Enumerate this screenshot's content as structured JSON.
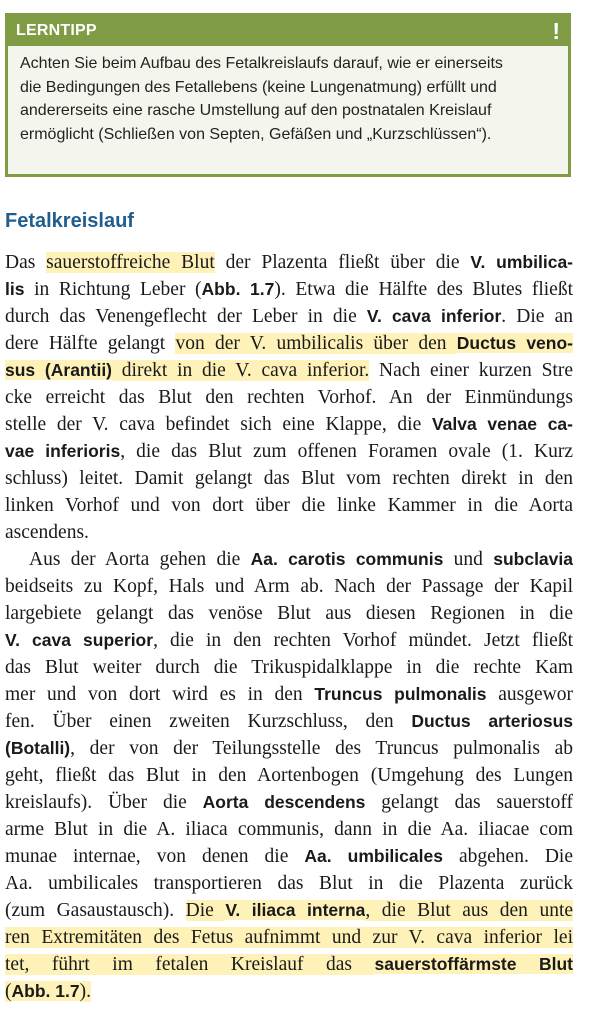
{
  "tip": {
    "title": "LERNTIPP",
    "icon": "exclamation-icon",
    "badge": "!",
    "color": "#7f9c45",
    "lines": [
      "Achten Sie beim Aufbau des Fetalkreislaufs darauf, wie er einerseits",
      "die Bedingungen des Fetallebens (keine Lungenatmung) erfüllt und",
      "andererseits eine rasche Umstellung auf den postnatalen Kreislauf",
      "ermöglicht (Schließen von Septen, Gefäßen und „Kurzschlüssen“)."
    ]
  },
  "heading": "Fetalkreislauf",
  "colors": {
    "heading": "#1f5e8e",
    "highlight": "#fff2b8"
  },
  "p1": {
    "l1": [
      "Das ",
      "sauerstoffreiche Blut",
      " der Plazenta fließt über die ",
      "V. umbilica-"
    ],
    "l2": [
      "lis",
      " in Richtung Leber (",
      "Abb. 1.7",
      "). Etwa die Hälfte des Blutes fließt"
    ],
    "l3": [
      "durch das Venengeflecht der Leber in die ",
      "V. cava inferior",
      ". Die an"
    ],
    "l4": [
      "dere Hälfte gelangt ",
      "von der V. umbilicalis über den ",
      "Ductus veno-"
    ],
    "l5": [
      "sus (Arantii)",
      " direkt in die V. cava inferior.",
      " Nach einer kurzen Stre"
    ],
    "l6": [
      "cke erreicht das Blut den rechten Vorhof. An der Einmündungs"
    ],
    "l7": [
      "stelle der V. cava befindet sich eine Klappe, die ",
      "Valva venae ca-"
    ],
    "l8": [
      "vae inferioris",
      ", die das Blut zum offenen Foramen ovale (1. Kurz"
    ],
    "l9": [
      "schluss) leitet. Damit gelangt das Blut vom rechten direkt in den"
    ],
    "l10": [
      "linken Vorhof und von dort über die linke Kammer in die Aorta"
    ],
    "l11": [
      "ascendens."
    ]
  },
  "p2": {
    "l1": [
      "Aus der Aorta gehen die ",
      "Aa. carotis communis",
      " und ",
      "subclavia"
    ],
    "l2": [
      "beidseits zu Kopf, Hals und Arm ab. Nach der Passage der Kapil"
    ],
    "l3": [
      "largebiete gelangt das venöse Blut aus diesen Regionen in die"
    ],
    "l4": [
      "V. cava superior",
      ", die in den rechten Vorhof mündet. Jetzt fließt"
    ],
    "l5": [
      "das Blut weiter durch die Trikuspidalklappe in die rechte Kam"
    ],
    "l6": [
      "mer und von dort wird es in den ",
      "Truncus pulmonalis",
      " ausgewor"
    ],
    "l7": [
      "fen. Über einen zweiten Kurzschluss, den ",
      "Ductus arteriosus"
    ],
    "l8": [
      "(Botalli)",
      ", der von der Teilungsstelle des Truncus pulmonalis ab"
    ],
    "l9": [
      "geht, fließt das Blut in den Aortenbogen (Umgehung des Lungen"
    ],
    "l10": [
      "kreislaufs). Über die ",
      "Aorta descendens",
      " gelangt das sauerstoff"
    ],
    "l11": [
      "arme Blut in die A. iliaca communis, dann in die Aa. iliacae com"
    ],
    "l12": [
      "munae internae, von denen die ",
      "Aa. umbilicales",
      " abgehen. Die"
    ],
    "l13": [
      "Aa. umbilicales transportieren das Blut in die Plazenta zurück"
    ],
    "l14": [
      "(zum Gasaustausch). ",
      "Die ",
      "V. iliaca interna",
      ", die Blut aus den unte"
    ],
    "l15": [
      "ren Extremitäten des Fetus aufnimmt und zur V. cava inferior lei"
    ],
    "l16": [
      "tet, führt im fetalen Kreislauf das ",
      "sauerstoffärmste Blut"
    ],
    "l17": [
      "(",
      "Abb. 1.7",
      ")."
    ]
  }
}
